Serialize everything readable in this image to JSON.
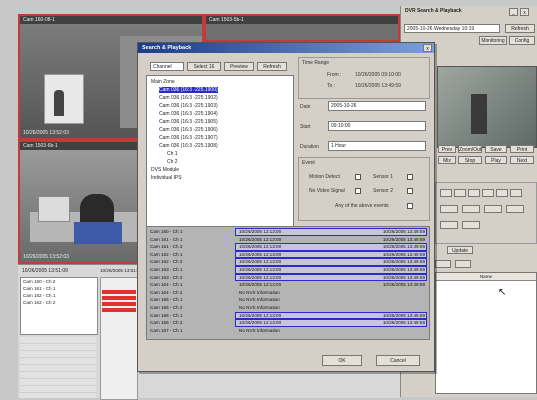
{
  "cameras": [
    {
      "title": "Cam 160-08-1",
      "timestamp": "10/26/2005 13:52:03"
    },
    {
      "title": "Cam 1503-5b-1",
      "timestamp": ""
    },
    {
      "title": "Cam 1503-6b-1",
      "timestamp": "10/26/2005 13:52:03"
    }
  ],
  "right_panel": {
    "title": "DVR Search & Playback",
    "date_field": "2005-10-26 Wednesday 10:19",
    "refresh_label": "Refresh",
    "monitoring_label": "Monitoring",
    "config_label": "Config",
    "btn_prev": "Prev",
    "btn_zoom": "Zoom/Out",
    "btn_save": "Save",
    "btn_print": "Print",
    "btn_mix": "Mix",
    "btn_stop": "Stop",
    "btn_play": "Play",
    "btn_next": "Next",
    "btn_update": "Update",
    "list_header": "Name"
  },
  "bottom_left": {
    "clock": "10/26/2005 13:51:09",
    "header": "10/26/2005 13:51:09",
    "cams": [
      "Cam 160 - Ch 2",
      "Cam 161 - Ch 1",
      "Cam 162 - Ch 1",
      "Cam 162 - Ch 2"
    ]
  },
  "dialog": {
    "title": "Search & Playback",
    "channel_select": "Channel",
    "select_all_label": "Select 16",
    "preview_label": "Preview",
    "refresh_label": "Refresh",
    "tree": [
      {
        "indent": 0,
        "text": "Main Zone"
      },
      {
        "indent": 1,
        "text": "Cam 036 (16:3 -225.1900)",
        "selected": true
      },
      {
        "indent": 1,
        "text": "Cam 036 (16:3 -225.1902)"
      },
      {
        "indent": 1,
        "text": "Cam 036 (16:3 -225.1903)"
      },
      {
        "indent": 1,
        "text": "Cam 036 (16:3 -225.1904)"
      },
      {
        "indent": 1,
        "text": "Cam 036 (16:3 -225.1905)"
      },
      {
        "indent": 1,
        "text": "Cam 036 (16:3 -225.1906)"
      },
      {
        "indent": 1,
        "text": "Cam 036 (16:3 -225.1907)"
      },
      {
        "indent": 1,
        "text": "Cam 036 (16:3 -225.1908)"
      },
      {
        "indent": 2,
        "text": "Ch 1"
      },
      {
        "indent": 2,
        "text": "Ch 2"
      },
      {
        "indent": 0,
        "text": "DVS Module"
      },
      {
        "indent": 0,
        "text": "Individual IPS"
      }
    ],
    "time_range_title": "Time Range",
    "from_label": "From :",
    "from_value": "10/26/2005 09:10:00",
    "to_label": "To :",
    "to_value": "10/26/2005 13:49:59",
    "date_label": "Date",
    "date_value": "2005-10-26",
    "start_label": "Start",
    "start_value": "09:10:00",
    "duration_label": "Duration",
    "duration_value": "1 Hour",
    "event_title": "Event",
    "motion_label": "Motion Detect",
    "sensor1_label": "Sensor 1",
    "novideo_label": "No Video Signal",
    "sensor2_label": "Sensor 2",
    "any_label": "Any of the above events",
    "results": [
      {
        "cam": "Cam 160 - Ch 1",
        "info": "10/26/2005 12:13:00",
        "right": "10/26/2005 13:49:59",
        "hl": true
      },
      {
        "cam": "Cam 161 - Ch 1",
        "info": "10/26/2005 12:13:00",
        "right": "10/26/2005 13:49:59",
        "hl": false
      },
      {
        "cam": "Cam 161 - Ch 2",
        "info": "10/26/2005 12:13:00",
        "right": "10/26/2005 13:49:59",
        "hl": true
      },
      {
        "cam": "Cam 162 - Ch 1",
        "info": "10/26/2005 12:13:00",
        "right": "10/26/2005 13:49:59",
        "hl": true
      },
      {
        "cam": "Cam 162 - Ch 2",
        "info": "10/26/2005 12:13:00",
        "right": "10/26/2005 13:49:59",
        "hl": true
      },
      {
        "cam": "Cam 163 - Ch 1",
        "info": "10/26/2005 12:13:00",
        "right": "10/26/2005 13:49:59",
        "hl": true
      },
      {
        "cam": "Cam 163 - Ch 2",
        "info": "10/26/2005 12:13:00",
        "right": "10/26/2005 13:49:59",
        "hl": true
      },
      {
        "cam": "Cam 164 - Ch 1",
        "info": "10/26/2005 12:13:00",
        "right": "10/26/2005 13:49:59",
        "hl": false
      },
      {
        "cam": "Cam 164 - Ch 2",
        "info": "No NVS Information",
        "right": "",
        "hl": false
      },
      {
        "cam": "Cam 165 - Ch 1",
        "info": "No NVS Information",
        "right": "",
        "hl": false
      },
      {
        "cam": "Cam 165 - Ch 2",
        "info": "No NVS Information",
        "right": "",
        "hl": false
      },
      {
        "cam": "Cam 166 - Ch 1",
        "info": "10/26/2005 12:13:00",
        "right": "10/26/2005 13:49:59",
        "hl": true
      },
      {
        "cam": "Cam 166 - Ch 2",
        "info": "10/26/2005 12:13:00",
        "right": "10/26/2005 13:49:59",
        "hl": true
      },
      {
        "cam": "Cam 167 - Ch 1",
        "info": "No NVS Information",
        "right": "",
        "hl": false
      }
    ],
    "ok_label": "OK",
    "cancel_label": "Cancel"
  },
  "colors": {
    "accent": "#2a2ad0",
    "alert": "#e03030",
    "frame": "#c23a3a"
  }
}
